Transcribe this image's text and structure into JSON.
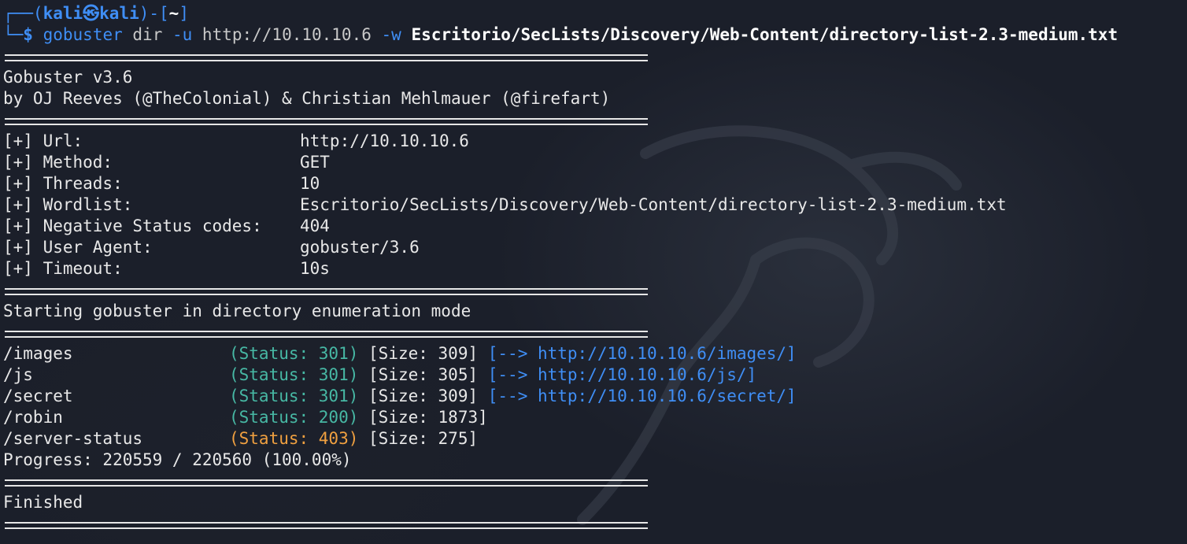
{
  "prompt": {
    "corner_top": "┌──(",
    "user": "kali",
    "at": "㉿",
    "host": "kali",
    "mid": ")-[",
    "dir": "~",
    "end": "]",
    "corner_bottom": "└─",
    "dollar": "$",
    "cmd": "gobuster",
    "subcmd": " dir ",
    "flag_u": "-u",
    "url_arg": " http://10.10.10.6 ",
    "flag_w": "-w",
    "wordlist_arg": " Escritorio/SecLists/Discovery/Web-Content/directory-list-2.3-medium.txt"
  },
  "banner": {
    "title": "Gobuster v3.6",
    "authors": "by OJ Reeves (@TheColonial) & Christian Mehlmauer (@firefart)"
  },
  "config": [
    {
      "label": "[+] Url:",
      "value": "http://10.10.10.6"
    },
    {
      "label": "[+] Method:",
      "value": "GET"
    },
    {
      "label": "[+] Threads:",
      "value": "10"
    },
    {
      "label": "[+] Wordlist:",
      "value": "Escritorio/SecLists/Discovery/Web-Content/directory-list-2.3-medium.txt"
    },
    {
      "label": "[+] Negative Status codes:",
      "value": "404"
    },
    {
      "label": "[+] User Agent:",
      "value": "gobuster/3.6"
    },
    {
      "label": "[+] Timeout:",
      "value": "10s"
    }
  ],
  "start_msg": "Starting gobuster in directory enumeration mode",
  "results": [
    {
      "path": "/images",
      "status": "(Status: 301)",
      "size": "[Size: 309]",
      "redirect": "[--> http://10.10.10.6/images/]"
    },
    {
      "path": "/js",
      "status": "(Status: 301)",
      "size": "[Size: 305]",
      "redirect": "[--> http://10.10.10.6/js/]"
    },
    {
      "path": "/secret",
      "status": "(Status: 301)",
      "size": "[Size: 309]",
      "redirect": "[--> http://10.10.10.6/secret/]"
    },
    {
      "path": "/robin",
      "status": "(Status: 200)",
      "size": "[Size: 1873]",
      "redirect": ""
    },
    {
      "path": "/server-status",
      "status": "(Status: 403)",
      "size": "[Size: 275]",
      "redirect": ""
    }
  ],
  "progress": "Progress: 220559 / 220560 (100.00%)",
  "finished": "Finished",
  "colors": {
    "background": "#1b1f2a",
    "prompt_blue": "#3f8ef5",
    "status_2xx_3xx": "#47b8a4",
    "status_403": "#f0a040"
  }
}
